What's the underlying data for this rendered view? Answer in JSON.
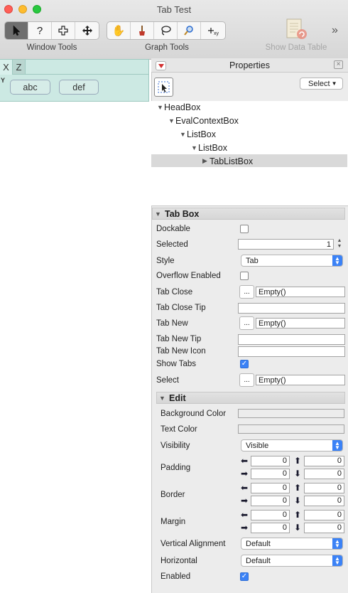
{
  "window": {
    "title": "Tab Test"
  },
  "toolbar": {
    "groups": [
      {
        "label": "Window Tools"
      },
      {
        "label": "Graph Tools"
      }
    ],
    "show_data_table": "Show Data Table",
    "overflow": "»"
  },
  "tabs": [
    {
      "label": "X",
      "selected": true
    },
    {
      "label": "Z",
      "selected": false
    }
  ],
  "tab_content": {
    "axis_label": "Y",
    "buttons": [
      "abc",
      "def"
    ]
  },
  "properties": {
    "title": "Properties",
    "select_button": "Select",
    "tree": [
      {
        "label": "HeadBox",
        "depth": 0,
        "expanded": true
      },
      {
        "label": "EvalContextBox",
        "depth": 1,
        "expanded": true
      },
      {
        "label": "ListBox",
        "depth": 2,
        "expanded": true
      },
      {
        "label": "ListBox",
        "depth": 3,
        "expanded": true
      },
      {
        "label": "TabListBox",
        "depth": 4,
        "expanded": false,
        "selected": true
      }
    ],
    "tabbox": {
      "header": "Tab Box",
      "dockable": {
        "label": "Dockable",
        "checked": false
      },
      "selected": {
        "label": "Selected",
        "value": "1"
      },
      "style": {
        "label": "Style",
        "value": "Tab"
      },
      "overflow": {
        "label": "Overflow Enabled",
        "checked": false
      },
      "tab_close": {
        "label": "Tab Close",
        "value": "Empty()"
      },
      "tab_close_tip": {
        "label": "Tab Close Tip",
        "value": ""
      },
      "tab_new": {
        "label": "Tab New",
        "value": "Empty()"
      },
      "tab_new_tip": {
        "label": "Tab New Tip",
        "value": ""
      },
      "tab_new_icon": {
        "label": "Tab New Icon",
        "value": ""
      },
      "show_tabs": {
        "label": "Show Tabs",
        "checked": true
      },
      "select": {
        "label": "Select",
        "value": "Empty()"
      }
    },
    "edit": {
      "header": "Edit",
      "background_color": {
        "label": "Background Color",
        "value": ""
      },
      "text_color": {
        "label": "Text Color",
        "value": ""
      },
      "visibility": {
        "label": "Visibility",
        "value": "Visible"
      },
      "padding": {
        "label": "Padding",
        "left": "0",
        "top": "0",
        "right": "0",
        "bottom": "0"
      },
      "border": {
        "label": "Border",
        "left": "0",
        "top": "0",
        "right": "0",
        "bottom": "0"
      },
      "margin": {
        "label": "Margin",
        "left": "0",
        "top": "0",
        "right": "0",
        "bottom": "0"
      },
      "vertical_alignment": {
        "label": "Vertical Alignment",
        "value": "Default"
      },
      "horizontal": {
        "label": "Horizontal",
        "value": "Default"
      },
      "enabled": {
        "label": "Enabled",
        "checked": true
      }
    }
  },
  "colors": {
    "accent": "#3b82f6",
    "tab_panel": "#cce9e3"
  }
}
